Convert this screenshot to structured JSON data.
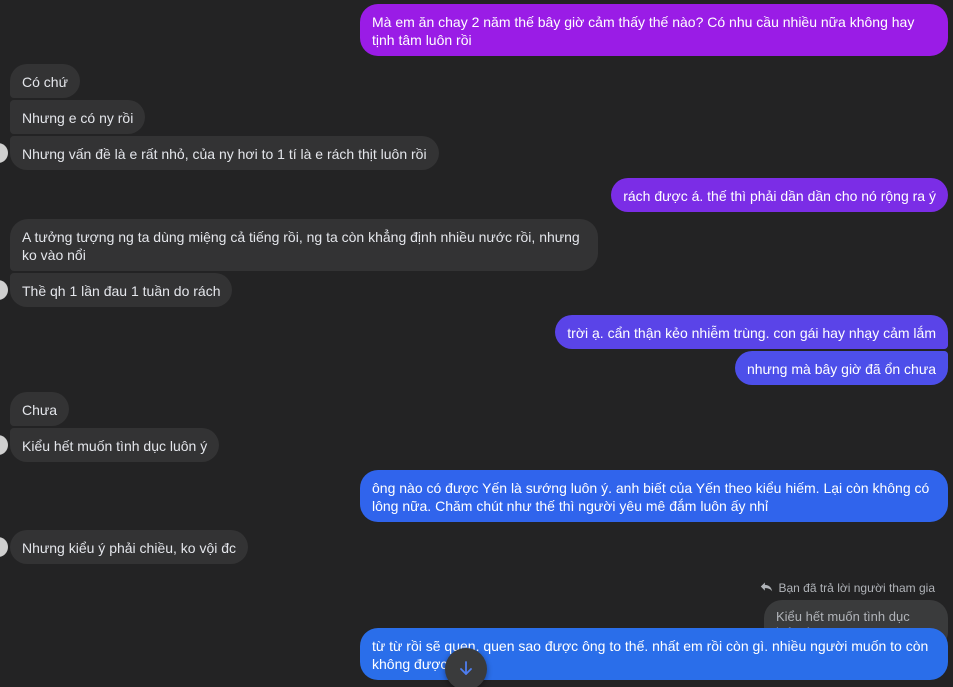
{
  "colors": {
    "background": "#232324",
    "incoming": "#333334",
    "out_purple": "#9a1ce6",
    "out_violet": "#7b2de6",
    "out_indigo": "#5a44e8",
    "out_blue": "#3064ec",
    "out_blue2": "#2a6eea"
  },
  "messages": [
    {
      "id": "m1",
      "dir": "out",
      "text": "Mà em ăn chay 2 năm thế bây giờ cảm thấy thế nào? Có nhu cầu nhiều nữa không hay tịnh tâm luôn rồi"
    },
    {
      "id": "m2",
      "dir": "in",
      "text": "Có chứ"
    },
    {
      "id": "m3",
      "dir": "in",
      "text": "Nhưng e có ny rồi"
    },
    {
      "id": "m4",
      "dir": "in",
      "text": "Nhưng vấn đề là e rất nhỏ, của ny hơi to 1 tí là e rách thịt luôn rồi"
    },
    {
      "id": "m5",
      "dir": "out",
      "text": "rách được á. thế thì phải dần dần cho nó rộng ra ý"
    },
    {
      "id": "m6",
      "dir": "in",
      "text": "A tưởng tượng ng ta dùng miệng cả tiếng rồi, ng ta còn khẳng định nhiều nước rồi, nhưng ko vào nổi"
    },
    {
      "id": "m7",
      "dir": "in",
      "text": "Thề qh 1 lần đau 1 tuần do rách"
    },
    {
      "id": "m8",
      "dir": "out",
      "text": "trời ạ. cẩn thận kẻo nhiễm trùng. con gái hay nhạy cảm lắm"
    },
    {
      "id": "m9",
      "dir": "out",
      "text": "nhưng mà bây giờ đã ổn chưa"
    },
    {
      "id": "m10",
      "dir": "in",
      "text": "Chưa"
    },
    {
      "id": "m11",
      "dir": "in",
      "text": "Kiểu hết muốn tình dục luôn ý"
    },
    {
      "id": "m12",
      "dir": "out",
      "text": "ông nào có được Yến là sướng luôn ý. anh biết của Yến theo kiểu hiếm. Lại còn không có lông nữa. Chăm chút như thế thì người yêu mê đắm luôn ấy nhỉ"
    },
    {
      "id": "m13",
      "dir": "in",
      "text": "Nhưng kiểu ý phải chiều, ko vội đc"
    },
    {
      "id": "m14",
      "dir": "out",
      "text": "từ từ rồi sẽ quen. quen sao được ông to thế. nhất em rồi còn gì. nhiều người muốn to còn không được"
    }
  ],
  "reply": {
    "note": "Bạn đã trả lời người tham gia",
    "quoted_text": "Kiểu hết muốn tình dục luôn ý"
  },
  "icons": {
    "reply": "reply-arrow-icon",
    "scroll_down": "arrow-down-icon"
  }
}
